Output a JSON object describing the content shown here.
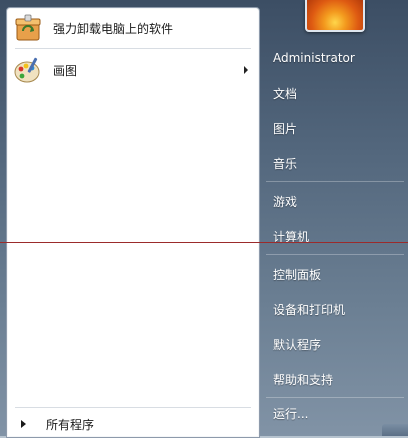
{
  "programs": [
    {
      "label": "强力卸载电脑上的软件",
      "icon": "uninstall-box-icon"
    },
    {
      "label": "画图",
      "icon": "paint-palette-icon",
      "has_submenu": true
    }
  ],
  "all_programs_label": "所有程序",
  "user": {
    "name": "Administrator"
  },
  "right_items": [
    {
      "label": "文档"
    },
    {
      "label": "图片"
    },
    {
      "label": "音乐"
    },
    {
      "label": "游戏"
    },
    {
      "label": "计算机"
    },
    {
      "label": "控制面板"
    },
    {
      "label": "设备和打印机"
    },
    {
      "label": "默认程序"
    },
    {
      "label": "帮助和支持"
    },
    {
      "label": "运行..."
    }
  ],
  "colors": {
    "guide_line": "#9b2b2b",
    "left_pane": "#ffffff"
  }
}
